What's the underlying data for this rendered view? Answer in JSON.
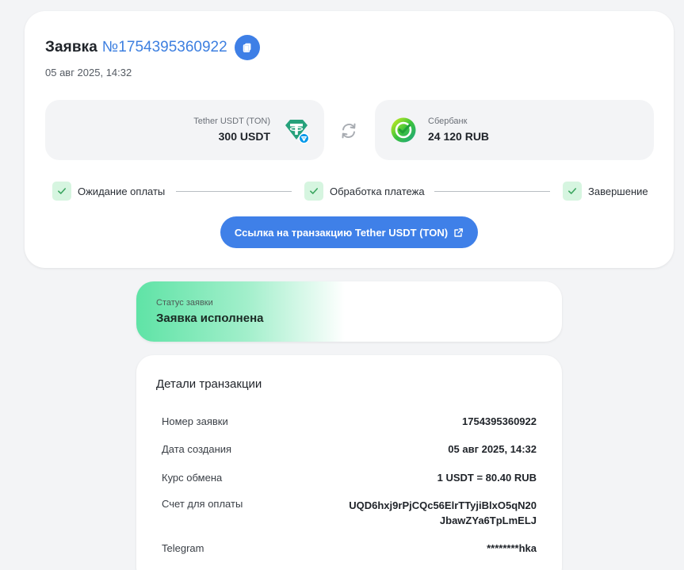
{
  "order": {
    "title": "Заявка",
    "number": "№1754395360922",
    "date": "05 авг 2025, 14:32"
  },
  "exchange": {
    "from": {
      "label": "Tether USDT (TON)",
      "amount": "300 USDT",
      "icon": "tether-ton-icon"
    },
    "to": {
      "label": "Сбербанк",
      "amount": "24 120 RUB",
      "icon": "sberbank-icon"
    }
  },
  "steps": [
    {
      "label": "Ожидание оплаты",
      "done": true
    },
    {
      "label": "Обработка платежа",
      "done": true
    },
    {
      "label": "Завершение",
      "done": true
    }
  ],
  "tx_link_label": "Ссылка на транзакцию Tether USDT (TON)",
  "status": {
    "label": "Статус заявки",
    "value": "Заявка исполнена"
  },
  "details": {
    "title": "Детали транзакции",
    "rows": [
      {
        "key": "Номер заявки",
        "value": "1754395360922"
      },
      {
        "key": "Дата создания",
        "value": "05 авг 2025, 14:32"
      },
      {
        "key": "Курс обмена",
        "value": "1 USDT = 80.40 RUB"
      },
      {
        "key": "Счет для оплаты",
        "value": "UQD6hxj9rPjCQc56ElrTTyjiBlxO5qN20JbawZYa6TpLmELJ"
      },
      {
        "key": "Telegram",
        "value": "********hka"
      }
    ]
  },
  "colors": {
    "accent": "#3f80e8",
    "success": "#4cc38a",
    "tether": "#26a17b"
  }
}
